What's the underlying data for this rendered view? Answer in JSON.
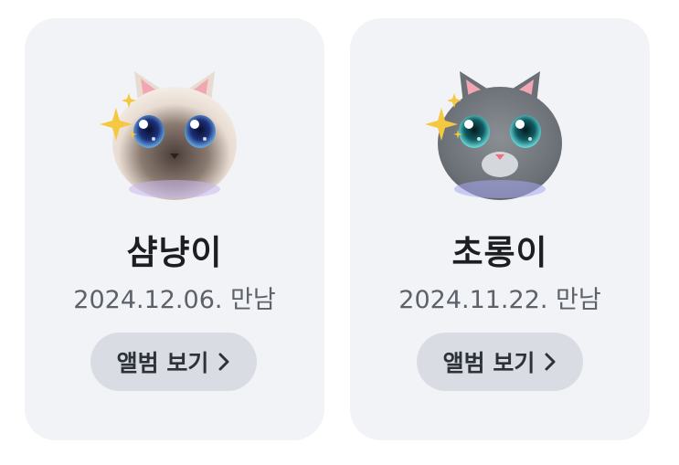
{
  "pets": [
    {
      "name": "샴냥이",
      "met_date": "2024.12.06. 만남",
      "album_label": "앨범 보기",
      "avatar_icon": "siamese-cat-face-icon"
    },
    {
      "name": "초롱이",
      "met_date": "2024.11.22. 만남",
      "album_label": "앨범 보기",
      "avatar_icon": "gray-cat-face-icon"
    }
  ],
  "colors": {
    "card_background": "#f1f3f6",
    "button_background": "#d9dde3",
    "name_text": "#1c1e22",
    "date_text": "#5d626a"
  }
}
